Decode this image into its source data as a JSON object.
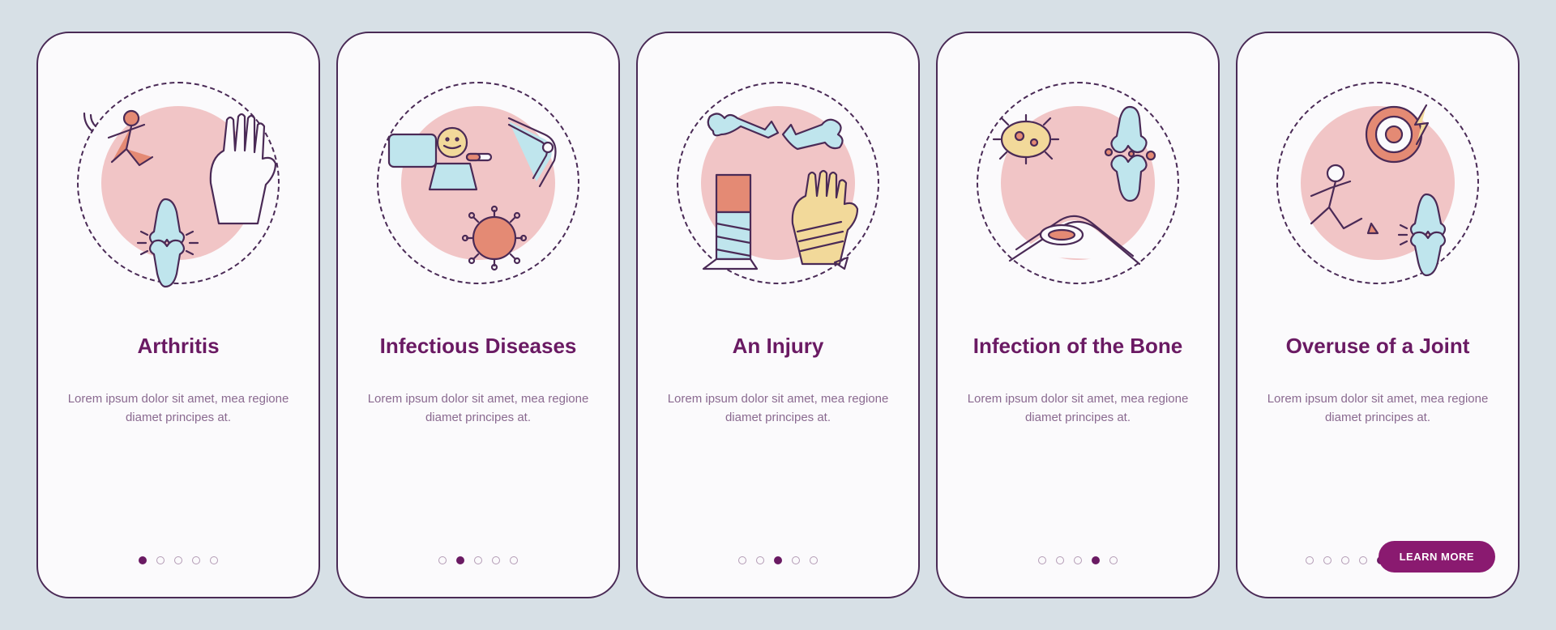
{
  "cards": [
    {
      "title": "Arthritis",
      "desc": "Lorem ipsum dolor sit amet, mea regione diamet principes at.",
      "active_index": 0
    },
    {
      "title": "Infectious Diseases",
      "desc": "Lorem ipsum dolor sit amet, mea regione diamet principes at.",
      "active_index": 1
    },
    {
      "title": "An Injury",
      "desc": "Lorem ipsum dolor sit amet, mea regione diamet principes at.",
      "active_index": 2
    },
    {
      "title": "Infection of the Bone",
      "desc": "Lorem ipsum dolor sit amet, mea regione diamet principes at.",
      "active_index": 3
    },
    {
      "title": "Overuse of a Joint",
      "desc": "Lorem ipsum dolor sit amet, mea regione diamet principes at.",
      "active_index": 4
    }
  ],
  "cta_label": "LEARN MORE",
  "dot_count": 5,
  "colors": {
    "accent": "#8a1a70",
    "title": "#6a1a63",
    "bg": "#d7e0e6",
    "pink": "#f1c5c6",
    "blue": "#bfe5ed",
    "yellow": "#f2d99a",
    "salmon": "#e48a74"
  }
}
